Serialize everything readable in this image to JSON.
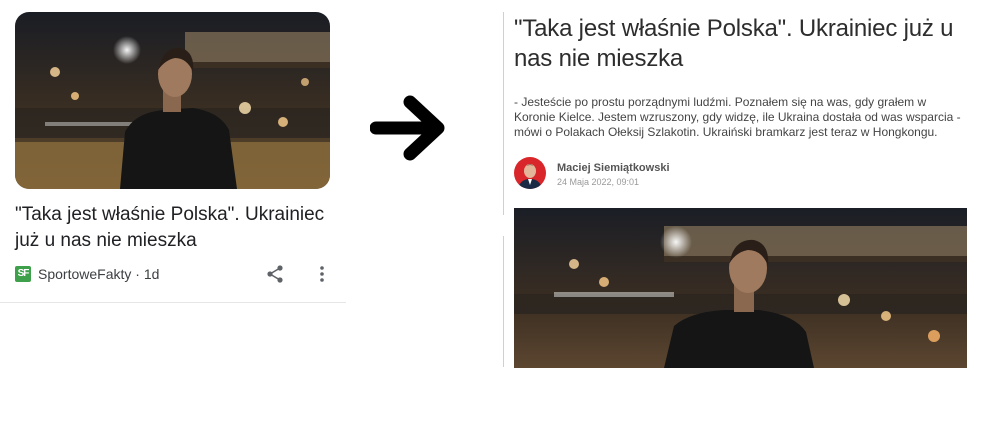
{
  "feed_card": {
    "title": "\"Taka jest właśnie Polska\". Ukrainiec już u nas nie mieszka",
    "source_logo_text": "SF",
    "source": "SportoweFakty · 1d",
    "icons": [
      "share-icon",
      "more-vert-icon"
    ]
  },
  "article": {
    "title": "\"Taka jest właśnie Polska\". Ukrainiec już u nas nie mieszka",
    "lead": "- Jesteście po prostu porządnymi ludźmi. Poznałem się na was, gdy grałem w Koronie Kielce. Jestem wzruszony, gdy widzę, ile Ukraina dostała od was wsparcia - mówi o Polakach Ołeksij Szlakotin. Ukraiński bramkarz jest teraz w Hongkongu.",
    "author": "Maciej Siemiątkowski",
    "date": "24 Maja 2022, 09:01"
  },
  "colors": {
    "source_logo": "#3ea04a",
    "divider_line": "#c9d6c2",
    "author_avatar_bg": "#d9262a"
  }
}
